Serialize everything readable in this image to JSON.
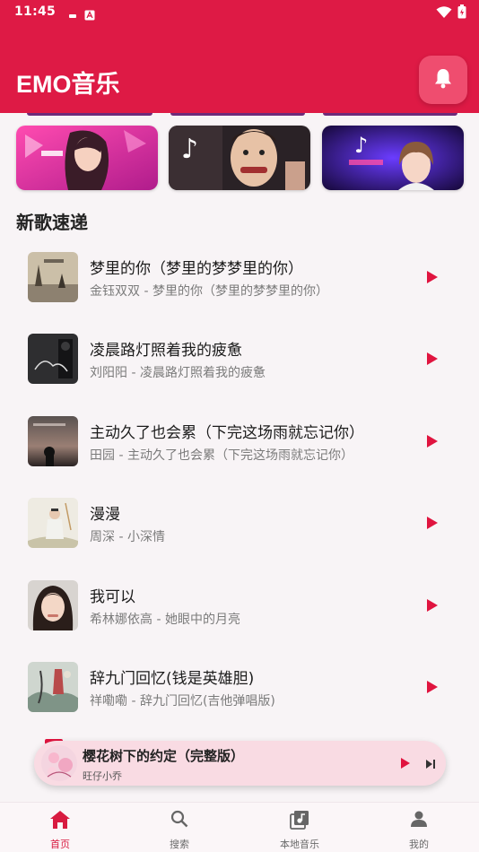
{
  "status_bar": {
    "time": "11:45"
  },
  "app": {
    "title": "EMO音乐"
  },
  "section": {
    "title": "新歌速递"
  },
  "songs": [
    {
      "title": "梦里的你（梦里的梦梦里的你）",
      "subtitle": "金钰双双 - 梦里的你（梦里的梦梦里的你）"
    },
    {
      "title": "凌晨路灯照着我的疲惫",
      "subtitle": "刘阳阳 - 凌晨路灯照着我的疲惫"
    },
    {
      "title": "主动久了也会累（下完这场雨就忘记你）",
      "subtitle": "田园 - 主动久了也会累（下完这场雨就忘记你）"
    },
    {
      "title": "漫漫",
      "subtitle": "周深 - 小深情"
    },
    {
      "title": "我可以",
      "subtitle": "希林娜依高 - 她眼中的月亮"
    },
    {
      "title": "辞九门回忆(钱是英雄胆)",
      "subtitle": "祥嘞嘞 - 辞九门回忆(吉他弹唱版)"
    }
  ],
  "now_playing": {
    "title": "樱花树下的约定（完整版）",
    "artist": "旺仔小乔"
  },
  "nav": [
    {
      "label": "首页"
    },
    {
      "label": "搜索"
    },
    {
      "label": "本地音乐"
    },
    {
      "label": "我的"
    }
  ],
  "colors": {
    "brand": "#de1a45",
    "accent": "#d81b40",
    "mini_player_bg": "#f9dbe3"
  }
}
